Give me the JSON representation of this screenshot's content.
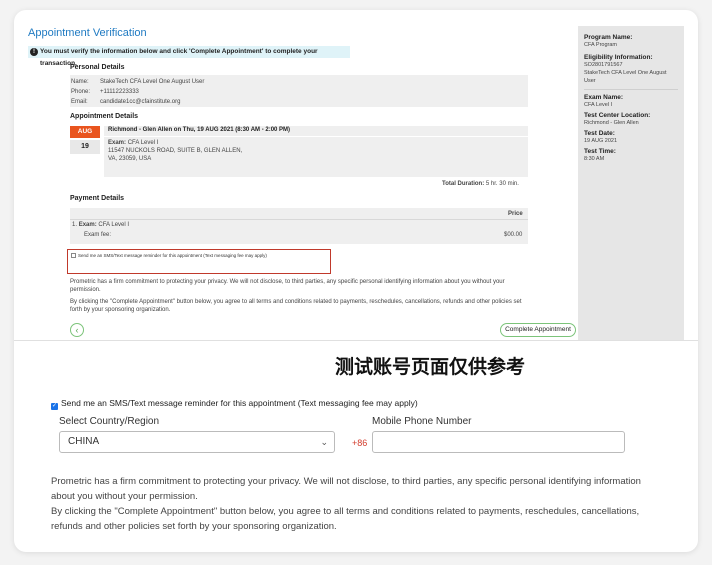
{
  "page_title": "Appointment Verification",
  "notice": "You must verify the information below and click 'Complete Appointment' to complete your transaction.",
  "personal": {
    "heading": "Personal Details",
    "rows": [
      {
        "label": "Name:",
        "value": "StakeTech CFA Level One August User"
      },
      {
        "label": "Phone:",
        "value": "+11112223333"
      },
      {
        "label": "Email:",
        "value": "candidate1cc@cfainstitute.org"
      }
    ]
  },
  "appointment": {
    "heading": "Appointment Details",
    "month": "AUG",
    "day": "19",
    "header": "Richmond - Glen Allen on Thu, 19 AUG 2021 (8:30 AM - 2:00 PM)",
    "exam_label": "Exam:",
    "exam_value": "CFA Level I",
    "address1": "11547 NUCKOLS ROAD, SUITE B, GLEN ALLEN,",
    "address2": "VA, 23059, USA",
    "duration_label": "Total Duration:",
    "duration_value": "5 hr. 30 min."
  },
  "payment": {
    "heading": "Payment Details",
    "price_header": "Price",
    "line1_prefix": "1.",
    "line1_label": "Exam:",
    "line1_value": "CFA Level I",
    "fee_label": "Exam fee:",
    "fee_value": "$00.00"
  },
  "sms_small": "Send me an SMS/Text message reminder for this appointment (Text messaging fee may apply)",
  "privacy_small_1": "Prometric has a firm commitment to protecting your privacy. We will not disclose, to third parties, any specific personal identifying information about you without your permission.",
  "privacy_small_2": "By clicking the \"Complete Appointment\" button below, you agree to all terms and conditions related to payments, reschedules, cancellations, refunds and other policies set forth by your sponsoring organization.",
  "complete_button": "Complete Appointment",
  "back_icon": "chevron-left-icon",
  "sidebar": [
    {
      "label": "Program Name:",
      "values": [
        "CFA Program"
      ]
    },
    {
      "label": "Eligibility Information:",
      "values": [
        "SO2801791567",
        "StakeTech CFA Level One August",
        "User"
      ]
    },
    {
      "label": "Exam Name:",
      "values": [
        "CFA Level I"
      ]
    },
    {
      "label": "Test Center Location:",
      "values": [
        "Richmond - Glen Allen"
      ]
    },
    {
      "label": "Test Date:",
      "values": [
        "19 AUG 2021"
      ]
    },
    {
      "label": "Test Time:",
      "values": [
        "8:30 AM"
      ]
    }
  ],
  "watermark": "测试账号页面仅供参考",
  "zoom": {
    "sms_label": "Send me an SMS/Text message reminder for this appointment (Text messaging fee may apply)",
    "sms_checked": true,
    "country_label": "Select Country/Region",
    "country_value": "CHINA",
    "phone_label": "Mobile Phone Number",
    "phone_prefix": "+86",
    "phone_value": "",
    "privacy_1": "Prometric has a firm commitment to protecting your privacy. We will not disclose, to third parties, any specific personal identifying information about you without your permission.",
    "privacy_2": "By clicking the \"Complete Appointment\" button below, you agree to all terms and conditions related to payments, reschedules, cancellations, refunds and other policies set forth by your sponsoring organization."
  },
  "colors": {
    "accent": "#1f7ac2",
    "month_badge": "#e9541e",
    "button_border": "#7cc47a",
    "highlight_box": "#c0392b",
    "prefix": "#d23b2b"
  }
}
